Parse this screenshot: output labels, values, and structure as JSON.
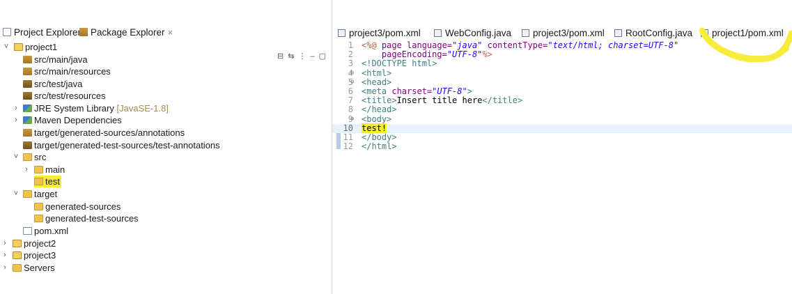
{
  "views": {
    "tabs": [
      {
        "label": "Project Explorer",
        "icon": "project-explorer-icon"
      },
      {
        "label": "Package Explorer",
        "icon": "package-explorer-icon"
      }
    ],
    "close_glyph": "×",
    "toolbar_icons": [
      "collapse-all-icon",
      "link-editor-icon",
      "view-menu-icon",
      "minimize-icon",
      "maximize-icon"
    ]
  },
  "tree": [
    {
      "label": "project1",
      "icon": "project-icon",
      "toggle": "˅"
    },
    {
      "label": "src/main/java",
      "icon": "source-folder-icon"
    },
    {
      "label": "src/main/resources",
      "icon": "source-folder-icon"
    },
    {
      "label": "src/test/java",
      "icon": "source-folder-icon"
    },
    {
      "label": "src/test/resources",
      "icon": "source-folder-icon"
    },
    {
      "label": "JRE System Library",
      "suffix": "[JavaSE-1.8]",
      "icon": "library-icon",
      "toggle": "›"
    },
    {
      "label": "Maven Dependencies",
      "icon": "library-icon",
      "toggle": "›"
    },
    {
      "label": "target/generated-sources/annotations",
      "icon": "source-folder-icon"
    },
    {
      "label": "target/generated-test-sources/test-annotations",
      "icon": "source-folder-icon"
    },
    {
      "label": "src",
      "icon": "folder-icon",
      "toggle": "˅"
    },
    {
      "label": "main",
      "icon": "folder-icon",
      "toggle": "›"
    },
    {
      "label": "test",
      "icon": "folder-icon"
    },
    {
      "label": "target",
      "icon": "folder-icon",
      "toggle": "˅"
    },
    {
      "label": "generated-sources",
      "icon": "folder-icon"
    },
    {
      "label": "generated-test-sources",
      "icon": "folder-icon"
    },
    {
      "label": "pom.xml",
      "icon": "xml-file-icon"
    },
    {
      "label": "project2",
      "icon": "project-icon",
      "toggle": "›"
    },
    {
      "label": "project3",
      "icon": "project-icon",
      "toggle": "›"
    },
    {
      "label": "Servers",
      "icon": "folder-icon",
      "toggle": "›"
    }
  ],
  "editor": {
    "tabs": [
      {
        "label": "project3/pom.xml",
        "icon": "maven-file-icon"
      },
      {
        "label": "WebConfig.java",
        "icon": "java-file-icon"
      },
      {
        "label": "project3/pom.xml",
        "icon": "maven-file-icon"
      },
      {
        "label": "RootConfig.java",
        "icon": "java-file-icon"
      },
      {
        "label": "project1/pom.xml",
        "icon": "maven-file-icon"
      }
    ],
    "lines": [
      {
        "n": "1",
        "fold": "",
        "tokens": [
          [
            "dir",
            "<%@ "
          ],
          [
            "attr",
            "page "
          ],
          [
            "attr",
            "language="
          ],
          [
            "val",
            "\"java\""
          ],
          [
            "plain",
            " "
          ],
          [
            "attr",
            "contentType="
          ],
          [
            "val",
            "\"text/html; charset=UTF-8\""
          ]
        ]
      },
      {
        "n": "2",
        "fold": "",
        "tokens": [
          [
            "plain",
            "    "
          ],
          [
            "attr",
            "pageEncoding="
          ],
          [
            "val",
            "\"UTF-8\""
          ],
          [
            "dir",
            "%>"
          ]
        ]
      },
      {
        "n": "3",
        "fold": "",
        "tokens": [
          [
            "tag",
            "<!DOCTYPE html>"
          ]
        ]
      },
      {
        "n": "4",
        "fold": "⊖",
        "tokens": [
          [
            "tag",
            "<html>"
          ]
        ]
      },
      {
        "n": "5",
        "fold": "⊖",
        "tokens": [
          [
            "tag",
            "<head>"
          ]
        ]
      },
      {
        "n": "6",
        "fold": "",
        "tokens": [
          [
            "tag",
            "<meta "
          ],
          [
            "attr",
            "charset="
          ],
          [
            "val",
            "\"UTF-8\""
          ],
          [
            "tag",
            ">"
          ]
        ]
      },
      {
        "n": "7",
        "fold": "",
        "tokens": [
          [
            "tag",
            "<title>"
          ],
          [
            "plain",
            "Insert title here"
          ],
          [
            "tag",
            "</title>"
          ]
        ]
      },
      {
        "n": "8",
        "fold": "",
        "tokens": [
          [
            "tag",
            "</head>"
          ]
        ]
      },
      {
        "n": "9",
        "fold": "⊖",
        "tokens": [
          [
            "tag",
            "<body>"
          ]
        ]
      },
      {
        "n": "10",
        "fold": "",
        "tokens": [
          [
            "plain",
            "test!"
          ]
        ]
      },
      {
        "n": "11",
        "fold": "",
        "tokens": [
          [
            "tag",
            "</body>"
          ]
        ]
      },
      {
        "n": "12",
        "fold": "",
        "tokens": [
          [
            "tag",
            "</html>"
          ]
        ]
      }
    ]
  },
  "colors": {
    "highlight": "#f8ec3a",
    "current_line": "#e8f2fe"
  }
}
